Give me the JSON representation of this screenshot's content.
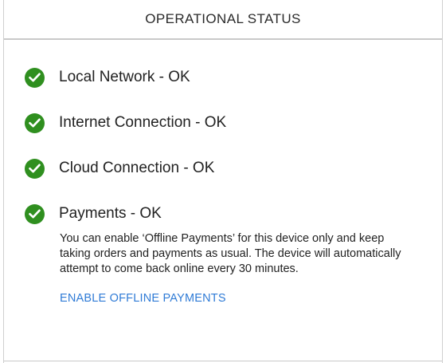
{
  "header": {
    "title": "OPERATIONAL STATUS"
  },
  "status_items": [
    {
      "label": "Local Network - OK",
      "icon": "check-circle-icon"
    },
    {
      "label": "Internet Connection - OK",
      "icon": "check-circle-icon"
    },
    {
      "label": "Cloud Connection - OK",
      "icon": "check-circle-icon"
    },
    {
      "label": "Payments - OK",
      "icon": "check-circle-icon"
    }
  ],
  "payments": {
    "description": "You can enable ‘Offline Payments’ for this device only and keep taking orders and payments as usual. The device will automatically attempt to come back online every 30 minutes.",
    "enable_link_label": "ENABLE OFFLINE PAYMENTS"
  },
  "colors": {
    "ok_green": "#2f8f1f",
    "link_blue": "#2f7bd6",
    "divider": "#c9c9c9"
  }
}
